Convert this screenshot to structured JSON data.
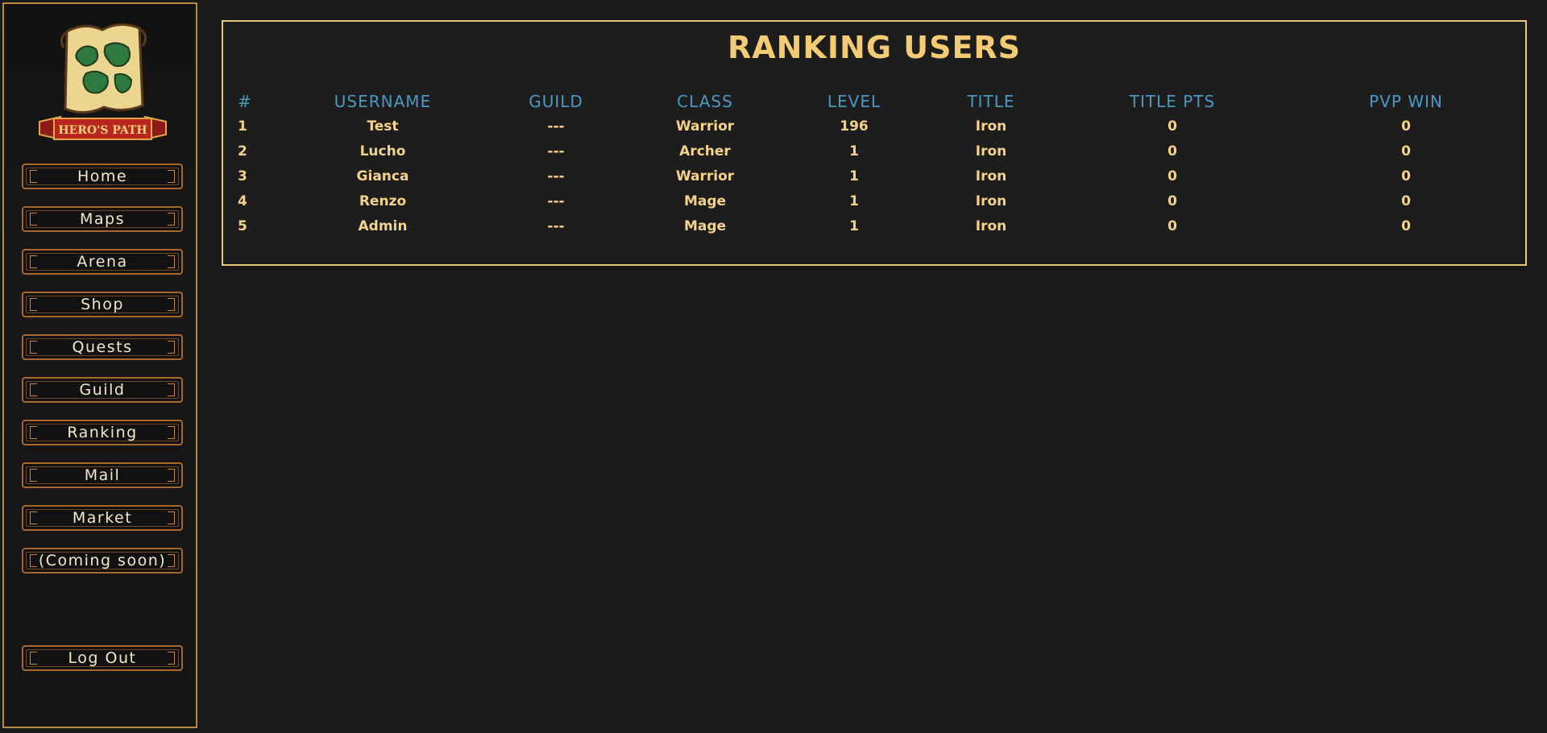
{
  "sidebar": {
    "logo_text": "HERO'S PATH",
    "nav": [
      {
        "label": "Home"
      },
      {
        "label": "Maps"
      },
      {
        "label": "Arena"
      },
      {
        "label": "Shop"
      },
      {
        "label": "Quests"
      },
      {
        "label": "Guild"
      },
      {
        "label": "Ranking"
      },
      {
        "label": "Mail"
      },
      {
        "label": "Market"
      },
      {
        "label": "(Coming soon)"
      }
    ],
    "logout_label": "Log Out"
  },
  "ranking": {
    "title": "RANKING USERS",
    "columns": [
      "#",
      "USERNAME",
      "GUILD",
      "CLASS",
      "LEVEL",
      "TITLE",
      "TITLE PTS",
      "PVP WIN"
    ],
    "rows": [
      [
        "1",
        "Test",
        "---",
        "Warrior",
        "196",
        "Iron",
        "0",
        "0"
      ],
      [
        "2",
        "Lucho",
        "---",
        "Archer",
        "1",
        "Iron",
        "0",
        "0"
      ],
      [
        "3",
        "Gianca",
        "---",
        "Warrior",
        "1",
        "Iron",
        "0",
        "0"
      ],
      [
        "4",
        "Renzo",
        "---",
        "Mage",
        "1",
        "Iron",
        "0",
        "0"
      ],
      [
        "5",
        "Admin",
        "---",
        "Mage",
        "1",
        "Iron",
        "0",
        "0"
      ]
    ]
  },
  "colors": {
    "background": "#191919",
    "gold_border": "#e8c97a",
    "title_gold": "#f2cb74",
    "header_blue": "#4b98c2",
    "cell_gold": "#f4d28a",
    "button_border": "#a8682c"
  }
}
